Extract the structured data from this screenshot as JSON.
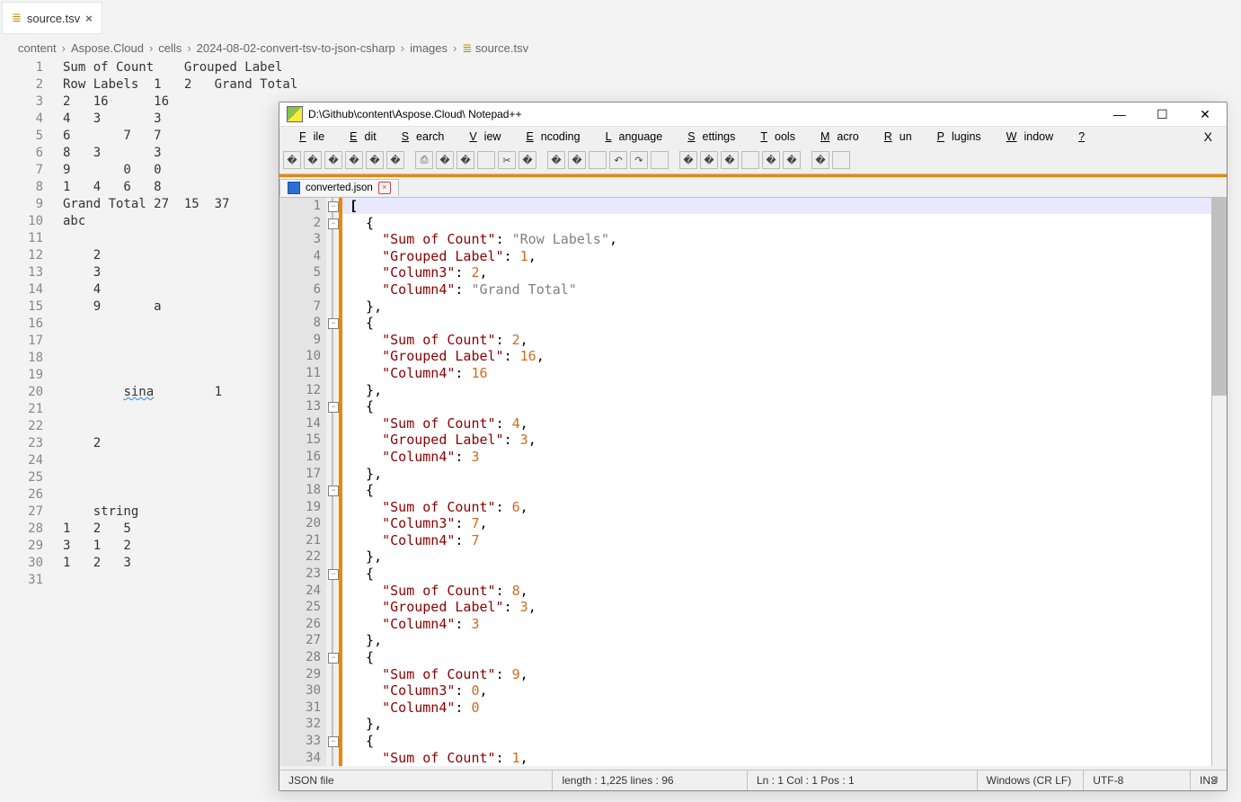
{
  "vscode": {
    "tab": {
      "icon": "≣",
      "label": "source.tsv",
      "close": "×"
    },
    "breadcrumb": [
      "content",
      "Aspose.Cloud",
      "cells",
      "2024-08-02-convert-tsv-to-json-csharp",
      "images",
      "source.tsv"
    ],
    "bc_icon": "≣",
    "sep": "›",
    "line_count": 31,
    "lines": [
      "Sum of Count    Grouped Label",
      "Row Labels  1   2   Grand Total",
      "2   16      16",
      "4   3       3",
      "6       7   7",
      "8   3       3",
      "9       0   0",
      "1   4   6   8",
      "Grand Total 27  15  37",
      "abc",
      "",
      "    2",
      "    3",
      "    4",
      "    9       a",
      "",
      "",
      "",
      "",
      "        sina        1",
      "",
      "",
      "    2",
      "",
      "",
      "",
      "    string",
      "1   2   5",
      "3   1   2",
      "1   2   3",
      ""
    ]
  },
  "npp": {
    "title": "D:\\Github\\content\\Aspose.Cloud\\ Notepad++",
    "win": {
      "min": "—",
      "max": "☐",
      "close": "✕"
    },
    "menu": [
      "File",
      "Edit",
      "Search",
      "View",
      "Encoding",
      "Language",
      "Settings",
      "Tools",
      "Macro",
      "Run",
      "Plugins",
      "Window",
      "?"
    ],
    "menu_x": "X",
    "filetab": {
      "name": "converted.json",
      "close": "×"
    },
    "line_count": 34,
    "fold_boxes": [
      1,
      2,
      8,
      13,
      18,
      23,
      28,
      33
    ],
    "toolbar_count": 30,
    "status": {
      "type": "JSON file",
      "len": "length : 1,225    lines : 96",
      "pos": "Ln : 1    Col : 1    Pos : 1",
      "eol": "Windows (CR LF)",
      "enc": "UTF-8",
      "ins": "INS"
    },
    "code": [
      [
        [
          "jb",
          "["
        ]
      ],
      [
        [
          "jp",
          "  {"
        ]
      ],
      [
        [
          "jp",
          "    "
        ],
        [
          "jk",
          "\"Sum of Count\""
        ],
        [
          "jp",
          ": "
        ],
        [
          "js",
          "\"Row Labels\""
        ],
        [
          "jp",
          ","
        ]
      ],
      [
        [
          "jp",
          "    "
        ],
        [
          "jk",
          "\"Grouped Label\""
        ],
        [
          "jp",
          ": "
        ],
        [
          "jn",
          "1"
        ],
        [
          "jp",
          ","
        ]
      ],
      [
        [
          "jp",
          "    "
        ],
        [
          "jk",
          "\"Column3\""
        ],
        [
          "jp",
          ": "
        ],
        [
          "jn",
          "2"
        ],
        [
          "jp",
          ","
        ]
      ],
      [
        [
          "jp",
          "    "
        ],
        [
          "jk",
          "\"Column4\""
        ],
        [
          "jp",
          ": "
        ],
        [
          "js",
          "\"Grand Total\""
        ]
      ],
      [
        [
          "jp",
          "  },"
        ]
      ],
      [
        [
          "jp",
          "  {"
        ]
      ],
      [
        [
          "jp",
          "    "
        ],
        [
          "jk",
          "\"Sum of Count\""
        ],
        [
          "jp",
          ": "
        ],
        [
          "jn",
          "2"
        ],
        [
          "jp",
          ","
        ]
      ],
      [
        [
          "jp",
          "    "
        ],
        [
          "jk",
          "\"Grouped Label\""
        ],
        [
          "jp",
          ": "
        ],
        [
          "jn",
          "16"
        ],
        [
          "jp",
          ","
        ]
      ],
      [
        [
          "jp",
          "    "
        ],
        [
          "jk",
          "\"Column4\""
        ],
        [
          "jp",
          ": "
        ],
        [
          "jn",
          "16"
        ]
      ],
      [
        [
          "jp",
          "  },"
        ]
      ],
      [
        [
          "jp",
          "  {"
        ]
      ],
      [
        [
          "jp",
          "    "
        ],
        [
          "jk",
          "\"Sum of Count\""
        ],
        [
          "jp",
          ": "
        ],
        [
          "jn",
          "4"
        ],
        [
          "jp",
          ","
        ]
      ],
      [
        [
          "jp",
          "    "
        ],
        [
          "jk",
          "\"Grouped Label\""
        ],
        [
          "jp",
          ": "
        ],
        [
          "jn",
          "3"
        ],
        [
          "jp",
          ","
        ]
      ],
      [
        [
          "jp",
          "    "
        ],
        [
          "jk",
          "\"Column4\""
        ],
        [
          "jp",
          ": "
        ],
        [
          "jn",
          "3"
        ]
      ],
      [
        [
          "jp",
          "  },"
        ]
      ],
      [
        [
          "jp",
          "  {"
        ]
      ],
      [
        [
          "jp",
          "    "
        ],
        [
          "jk",
          "\"Sum of Count\""
        ],
        [
          "jp",
          ": "
        ],
        [
          "jn",
          "6"
        ],
        [
          "jp",
          ","
        ]
      ],
      [
        [
          "jp",
          "    "
        ],
        [
          "jk",
          "\"Column3\""
        ],
        [
          "jp",
          ": "
        ],
        [
          "jn",
          "7"
        ],
        [
          "jp",
          ","
        ]
      ],
      [
        [
          "jp",
          "    "
        ],
        [
          "jk",
          "\"Column4\""
        ],
        [
          "jp",
          ": "
        ],
        [
          "jn",
          "7"
        ]
      ],
      [
        [
          "jp",
          "  },"
        ]
      ],
      [
        [
          "jp",
          "  {"
        ]
      ],
      [
        [
          "jp",
          "    "
        ],
        [
          "jk",
          "\"Sum of Count\""
        ],
        [
          "jp",
          ": "
        ],
        [
          "jn",
          "8"
        ],
        [
          "jp",
          ","
        ]
      ],
      [
        [
          "jp",
          "    "
        ],
        [
          "jk",
          "\"Grouped Label\""
        ],
        [
          "jp",
          ": "
        ],
        [
          "jn",
          "3"
        ],
        [
          "jp",
          ","
        ]
      ],
      [
        [
          "jp",
          "    "
        ],
        [
          "jk",
          "\"Column4\""
        ],
        [
          "jp",
          ": "
        ],
        [
          "jn",
          "3"
        ]
      ],
      [
        [
          "jp",
          "  },"
        ]
      ],
      [
        [
          "jp",
          "  {"
        ]
      ],
      [
        [
          "jp",
          "    "
        ],
        [
          "jk",
          "\"Sum of Count\""
        ],
        [
          "jp",
          ": "
        ],
        [
          "jn",
          "9"
        ],
        [
          "jp",
          ","
        ]
      ],
      [
        [
          "jp",
          "    "
        ],
        [
          "jk",
          "\"Column3\""
        ],
        [
          "jp",
          ": "
        ],
        [
          "jn",
          "0"
        ],
        [
          "jp",
          ","
        ]
      ],
      [
        [
          "jp",
          "    "
        ],
        [
          "jk",
          "\"Column4\""
        ],
        [
          "jp",
          ": "
        ],
        [
          "jn",
          "0"
        ]
      ],
      [
        [
          "jp",
          "  },"
        ]
      ],
      [
        [
          "jp",
          "  {"
        ]
      ],
      [
        [
          "jp",
          "    "
        ],
        [
          "jk",
          "\"Sum of Count\""
        ],
        [
          "jp",
          ": "
        ],
        [
          "jn",
          "1"
        ],
        [
          "jp",
          ","
        ]
      ]
    ]
  }
}
